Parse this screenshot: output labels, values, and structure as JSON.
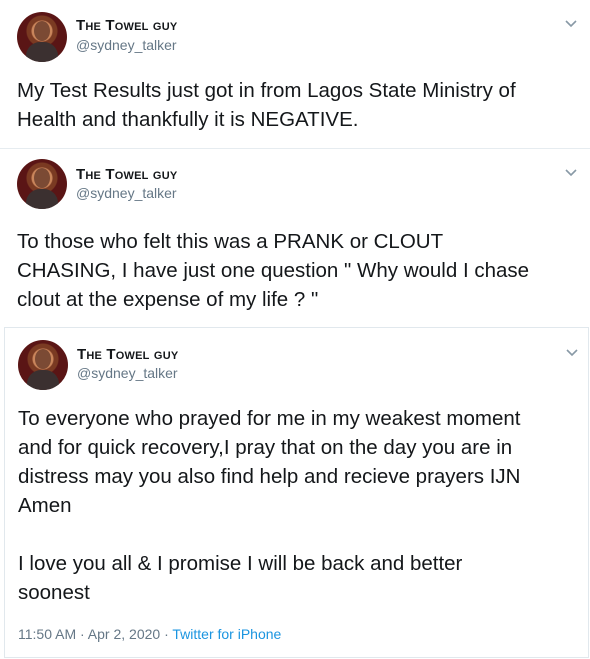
{
  "tweets": [
    {
      "name": "The Towel guy",
      "handle": "@sydney_talker",
      "text": "My Test Results just got in from Lagos State Ministry of\nHealth and thankfully it is NEGATIVE."
    },
    {
      "name": "The Towel guy",
      "handle": "@sydney_talker",
      "text": "To those who felt this was a PRANK or CLOUT\nCHASING, I have just one question \" Why would I chase\nclout at the expense of my life ? \""
    },
    {
      "name": "The Towel guy",
      "handle": "@sydney_talker",
      "text": "To everyone who prayed for me in my weakest moment\nand for quick recovery,I pray that on the day you are in\ndistress may you also find help and recieve prayers IJN\nAmen\n\nI love you all & I promise I will be back and better\nsoonest",
      "time": "11:50 AM",
      "date": "Apr 2, 2020",
      "source": "Twitter for iPhone"
    }
  ],
  "colors": {
    "text": "#14171a",
    "secondary": "#657786",
    "link": "#1b95e0",
    "border": "#e1e8ed"
  },
  "icons": [
    "chevron-down-icon"
  ]
}
